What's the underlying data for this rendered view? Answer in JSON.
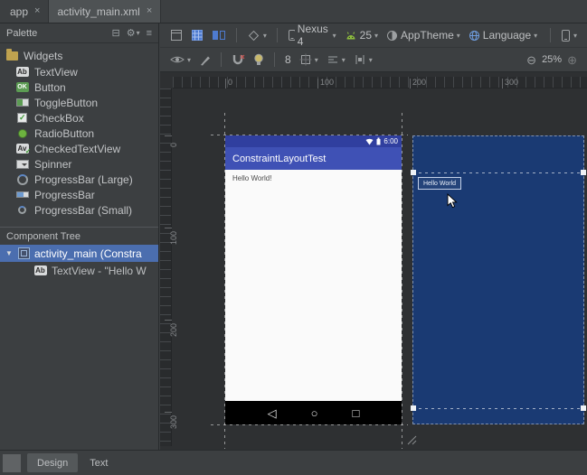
{
  "icons": {
    "close": "×",
    "dropdown": "▾",
    "expanded": "▼",
    "zoom_out": "⊖",
    "zoom_in": "⊕",
    "gear": "⚙",
    "collapse": "⊟",
    "view_list": "≡",
    "back": "◁",
    "home": "○",
    "recents": "□"
  },
  "editor_tabs": [
    {
      "label": "app"
    },
    {
      "label": "activity_main.xml"
    }
  ],
  "toolbar": {
    "device": "Nexus 4",
    "api": "25",
    "theme": "AppTheme",
    "language": "Language",
    "default_margin": "8",
    "zoom": "25%"
  },
  "palette": {
    "title": "Palette",
    "group": "Widgets",
    "items": [
      {
        "label": "TextView",
        "badge": "Ab"
      },
      {
        "label": "Button",
        "badge": "OK"
      },
      {
        "label": "ToggleButton"
      },
      {
        "label": "CheckBox"
      },
      {
        "label": "RadioButton"
      },
      {
        "label": "CheckedTextView",
        "badge": "Av"
      },
      {
        "label": "Spinner"
      },
      {
        "label": "ProgressBar (Large)"
      },
      {
        "label": "ProgressBar"
      },
      {
        "label": "ProgressBar (Small)"
      }
    ]
  },
  "component_tree": {
    "title": "Component Tree",
    "root_label": "activity_main (Constra",
    "child_label": "TextView - \"Hello W"
  },
  "rulers": {
    "h": [
      "0",
      "100",
      "200",
      "300"
    ],
    "v": [
      "0",
      "100",
      "200",
      "300"
    ]
  },
  "device_screen": {
    "app_title": "ConstraintLayoutTest",
    "time": "6:00",
    "content_text": "Hello World!"
  },
  "blueprint": {
    "widget_label": "Hello World"
  },
  "bottom_tabs": [
    {
      "label": "Design"
    },
    {
      "label": "Text"
    }
  ],
  "colors": {
    "appbar": "#3f51b5",
    "statusbar": "#303f9f",
    "blueprint_bg": "#1a3a73",
    "selection": "#4b6eaf"
  }
}
